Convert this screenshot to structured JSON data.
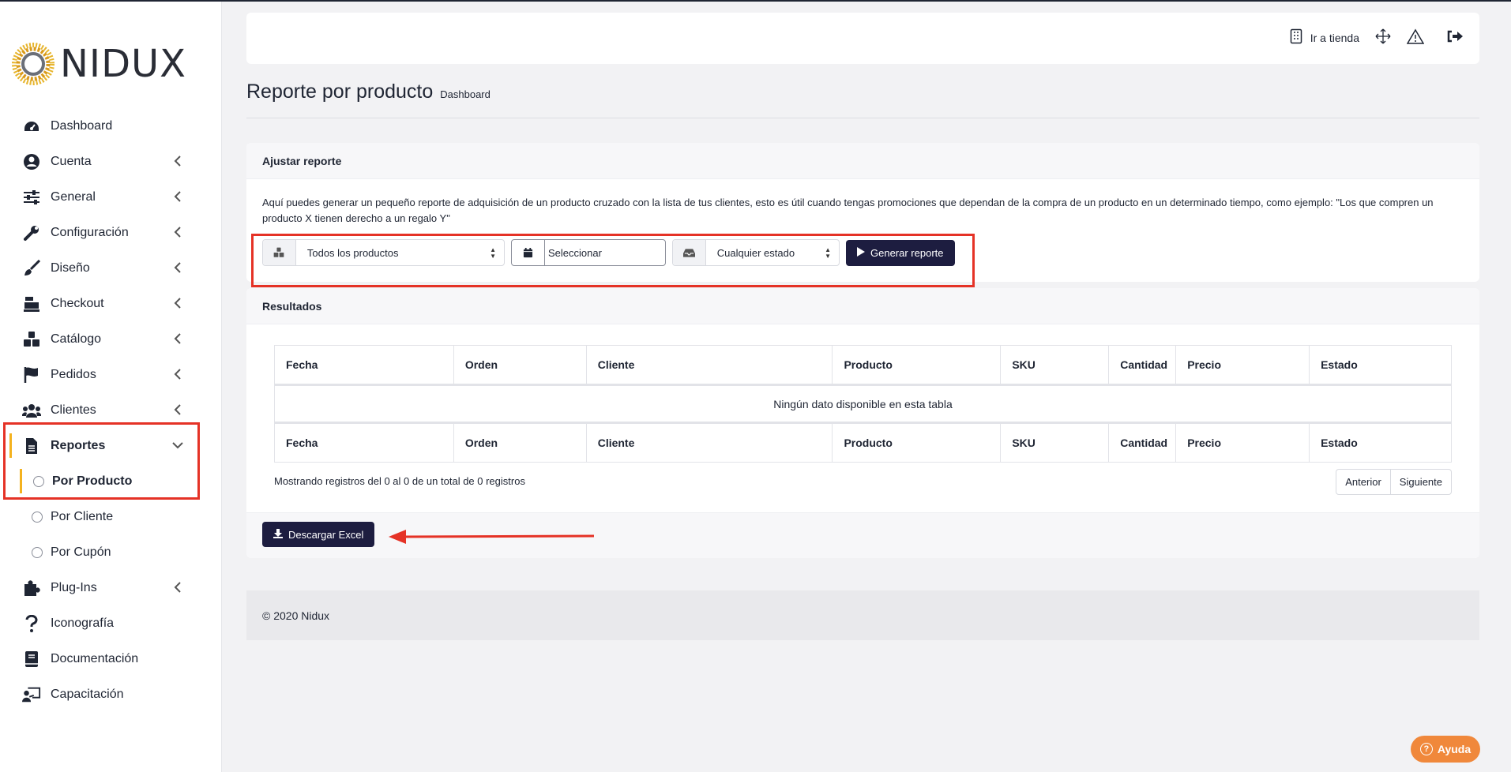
{
  "brand": {
    "name": "NIDUX",
    "accent": "#f4b21f",
    "dark_button": "#1d1d40",
    "highlight": "#e53226"
  },
  "sidebar": {
    "items": [
      {
        "label": "Dashboard",
        "icon": "dashboard-icon",
        "has_children": false
      },
      {
        "label": "Cuenta",
        "icon": "user-circle-icon",
        "has_children": true
      },
      {
        "label": "General",
        "icon": "sliders-icon",
        "has_children": true
      },
      {
        "label": "Configuración",
        "icon": "wrench-icon",
        "has_children": true
      },
      {
        "label": "Diseño",
        "icon": "brush-icon",
        "has_children": true
      },
      {
        "label": "Checkout",
        "icon": "cash-register-icon",
        "has_children": true
      },
      {
        "label": "Catálogo",
        "icon": "cubes-icon",
        "has_children": true
      },
      {
        "label": "Pedidos",
        "icon": "flag-icon",
        "has_children": true
      },
      {
        "label": "Clientes",
        "icon": "users-icon",
        "has_children": true
      },
      {
        "label": "Reportes",
        "icon": "file-icon",
        "has_children": true,
        "expanded": true,
        "active": true
      },
      {
        "label": "Plug-Ins",
        "icon": "puzzle-icon",
        "has_children": true
      },
      {
        "label": "Iconografía",
        "icon": "question-icon",
        "has_children": false
      },
      {
        "label": "Documentación",
        "icon": "book-icon",
        "has_children": false
      },
      {
        "label": "Capacitación",
        "icon": "chalkboard-teacher-icon",
        "has_children": false
      }
    ],
    "reportes_sub": [
      {
        "label": "Por Producto",
        "active": true
      },
      {
        "label": "Por Cliente",
        "active": false
      },
      {
        "label": "Por Cupón",
        "active": false
      }
    ]
  },
  "topbar": {
    "store_link": "Ir a tienda",
    "icons": [
      "store-icon",
      "expand-icon",
      "warning-icon",
      "logout-icon"
    ]
  },
  "page": {
    "title": "Reporte por producto",
    "breadcrumb": "Dashboard"
  },
  "adjust": {
    "header": "Ajustar reporte",
    "description": "Aquí puedes generar un pequeño reporte de adquisición de un producto cruzado con la lista de tus clientes, esto es útil cuando tengas promociones que dependan de la compra de un producto en un determinado tiempo, como ejemplo: \"Los que compren un producto X tienen derecho a un regalo Y\"",
    "product_select": "Todos los productos",
    "date_placeholder": "Seleccionar",
    "status_select": "Cualquier estado",
    "generate_button": "Generar reporte"
  },
  "results": {
    "header": "Resultados",
    "columns": [
      "Fecha",
      "Orden",
      "Cliente",
      "Producto",
      "SKU",
      "Cantidad",
      "Precio",
      "Estado"
    ],
    "empty_message": "Ningún dato disponible en esta tabla",
    "info": "Mostrando registros del 0 al 0 de un total de 0 registros",
    "prev": "Anterior",
    "next": "Siguiente",
    "download_button": "Descargar Excel"
  },
  "footer": {
    "copyright": "© 2020 Nidux"
  },
  "help": {
    "label": "Ayuda"
  }
}
